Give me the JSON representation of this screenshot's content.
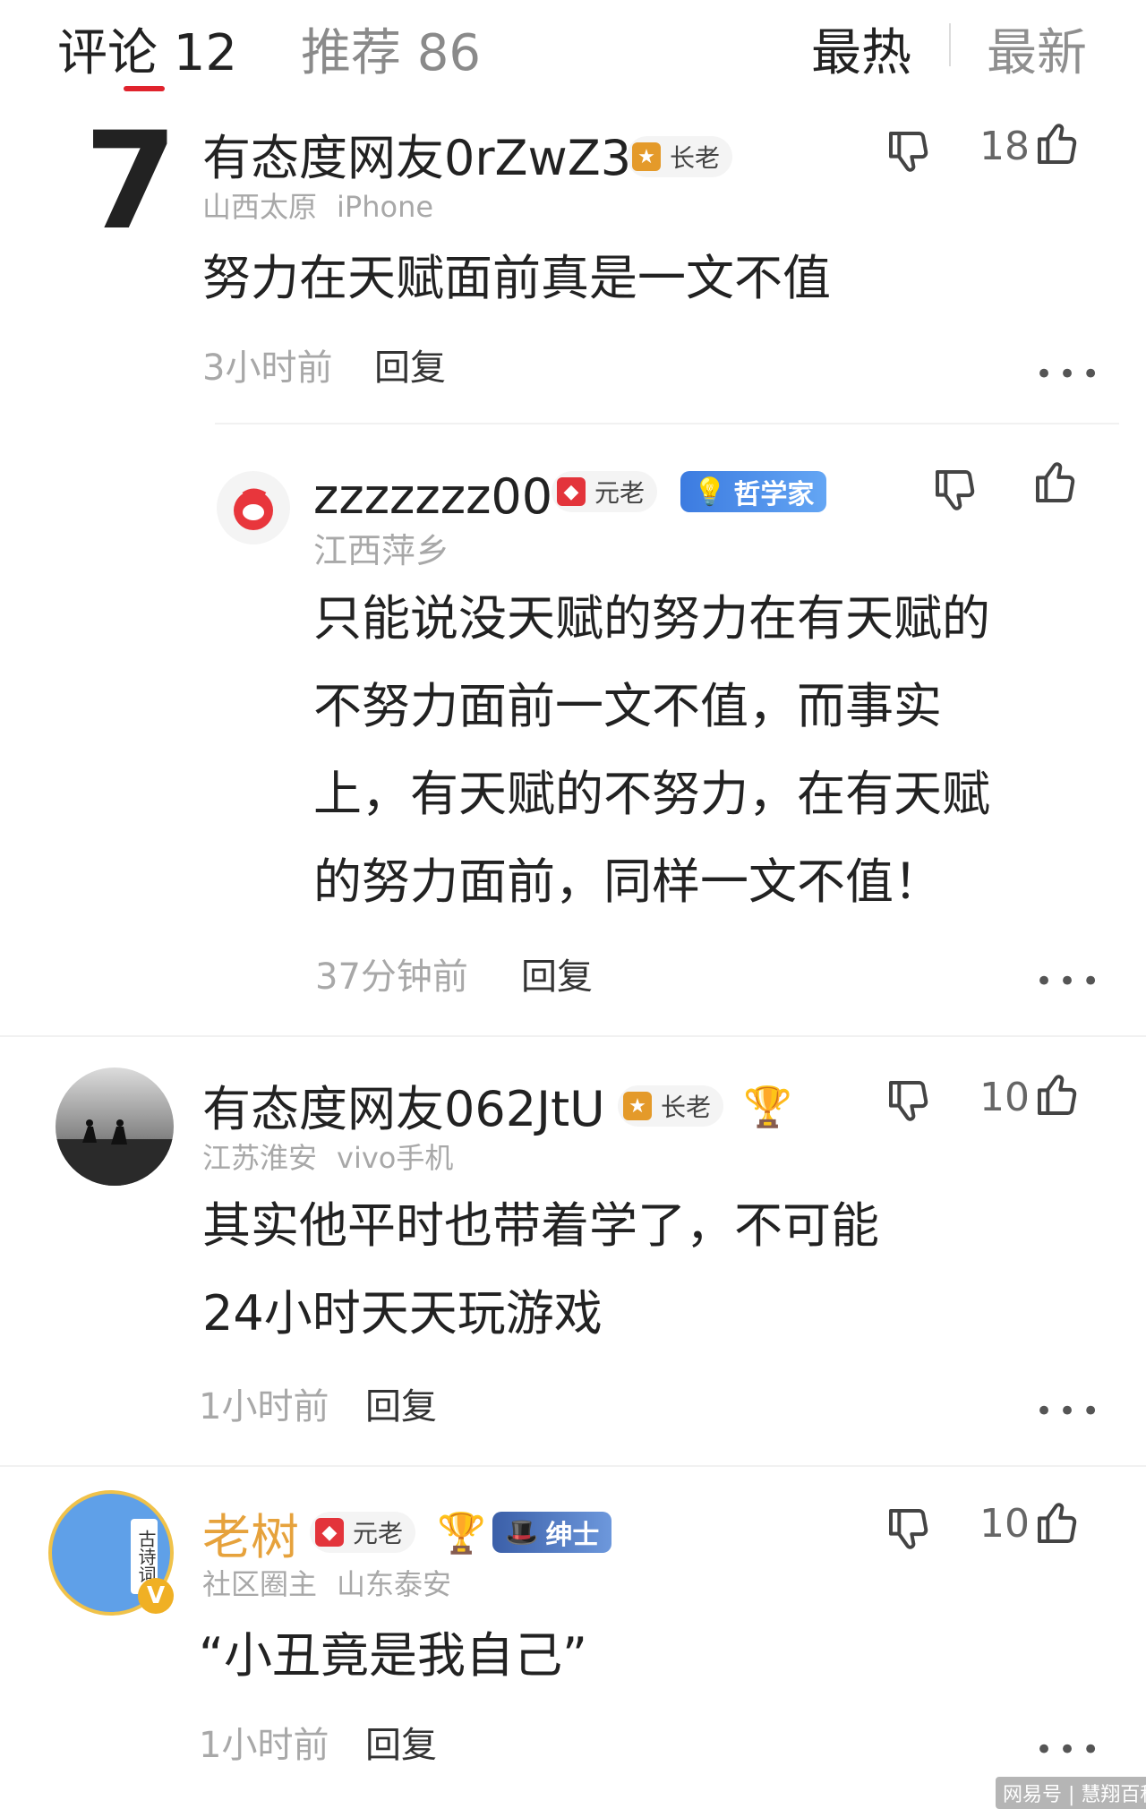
{
  "header": {
    "tab_comments": "评论 12",
    "tab_recommend": "推荐 86",
    "sort_hot": "最热",
    "sort_new": "最新"
  },
  "comments": [
    {
      "rank": "7",
      "name": "有态度网友0rZwZ3",
      "badge": "长老",
      "location": "山西太原",
      "device": "iPhone",
      "text": "努力在天赋面前真是一文不值",
      "time": "3小时前",
      "reply": "回复",
      "likes": "18",
      "more": "•••"
    },
    {
      "name": "zzzzzzz00",
      "badge": "元老",
      "title_badge": "哲学家",
      "location": "江西萍乡",
      "text_lines": [
        "只能说没天赋的努力在有天赋的",
        "不努力面前一文不值，而事实",
        "上，有天赋的不努力，在有天赋",
        "的努力面前，同样一文不值！"
      ],
      "time": "37分钟前",
      "reply": "回复",
      "more": "•••"
    },
    {
      "name": "有态度网友062JtU",
      "badge": "长老",
      "location": "江苏淮安",
      "device": "vivo手机",
      "text_lines": [
        "其实他平时也带着学了，不可能",
        "24小时天天玩游戏"
      ],
      "time": "1小时前",
      "reply": "回复",
      "likes": "10",
      "more": "•••"
    },
    {
      "name": "老树",
      "badge": "元老",
      "title_badge": "绅士",
      "location_prefix": "社区圈主",
      "location": "山东泰安",
      "text": "“小丑竟是我自己”",
      "time": "1小时前",
      "reply": "回复",
      "likes": "10",
      "more": "•••",
      "avatar_text": "古诗词",
      "avatar_badge": "V"
    }
  ],
  "watermark": "网易号 | 慧翔百科",
  "colors": {
    "accent_red": "#e0232d",
    "gold_name": "#e6a23c",
    "muted": "#a8a8a8"
  }
}
